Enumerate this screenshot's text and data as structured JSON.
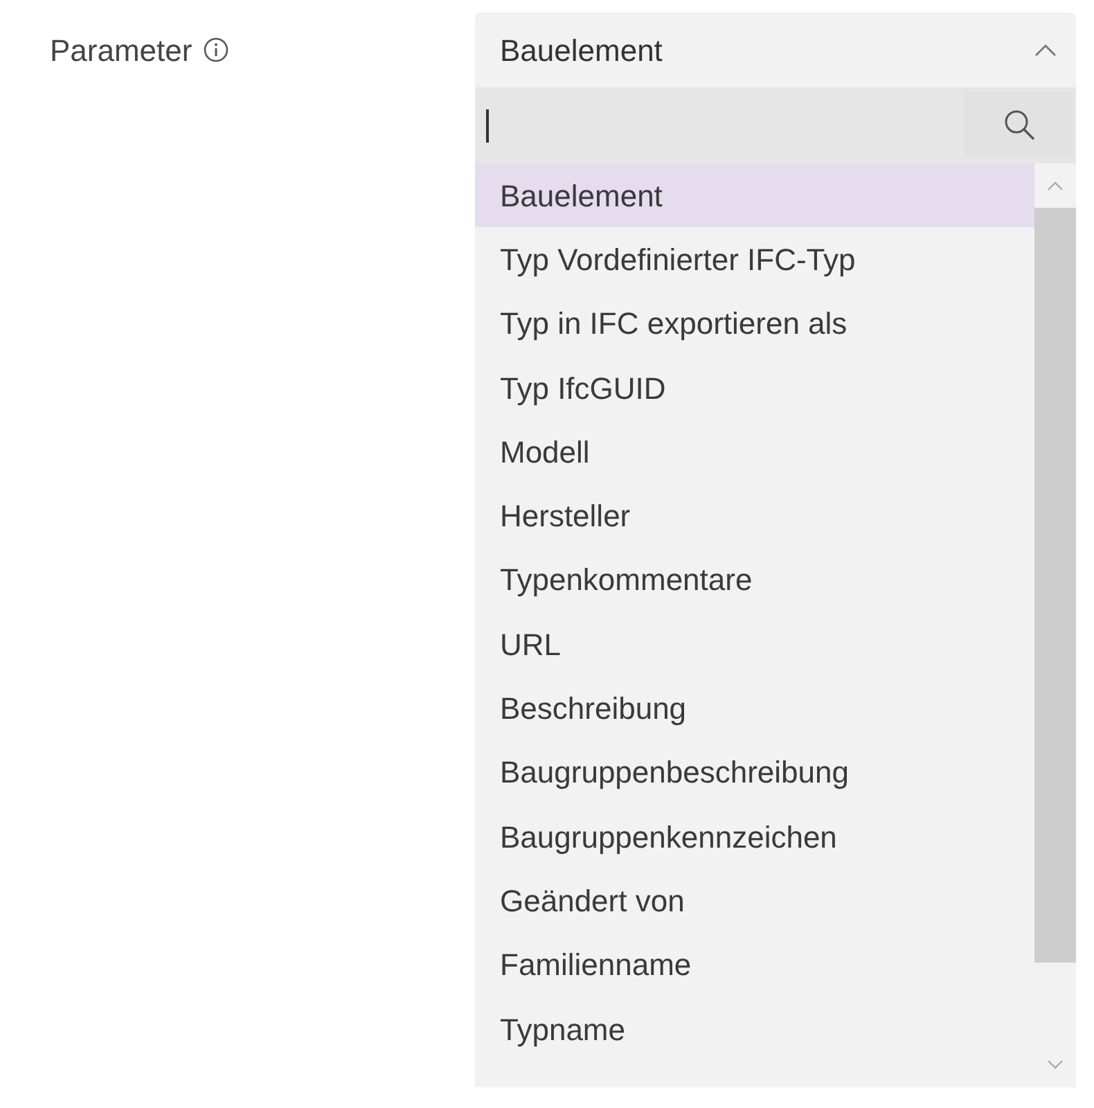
{
  "field": {
    "label": "Parameter"
  },
  "dropdown": {
    "value": "Bauelement",
    "expanded": true,
    "options": [
      {
        "label": "Bauelement",
        "selected": true
      },
      {
        "label": "Typ Vordefinierter IFC-Typ",
        "selected": false
      },
      {
        "label": "Typ in IFC exportieren als",
        "selected": false
      },
      {
        "label": "Typ IfcGUID",
        "selected": false
      },
      {
        "label": "Modell",
        "selected": false
      },
      {
        "label": "Hersteller",
        "selected": false
      },
      {
        "label": "Typenkommentare",
        "selected": false
      },
      {
        "label": "URL",
        "selected": false
      },
      {
        "label": "Beschreibung",
        "selected": false
      },
      {
        "label": "Baugruppenbeschreibung",
        "selected": false
      },
      {
        "label": "Baugruppenkennzeichen",
        "selected": false
      },
      {
        "label": "Geändert von",
        "selected": false
      },
      {
        "label": "Familienname",
        "selected": false
      },
      {
        "label": "Typname",
        "selected": false
      }
    ]
  }
}
